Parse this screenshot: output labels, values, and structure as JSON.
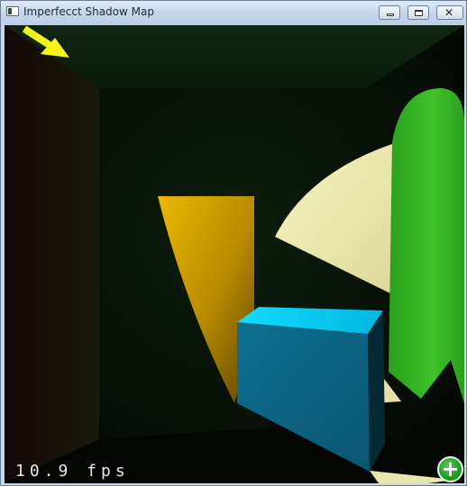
{
  "window": {
    "title": "Imperfecct Shadow Map",
    "icon": "window-app-icon"
  },
  "controls": {
    "minimize": "minimize-icon",
    "maximize": "maximize-icon",
    "close": "✕"
  },
  "overlay": {
    "fps_text": "10.9 fps",
    "add_button_glyph": "+",
    "light_pointer": "arrow-pointer-icon"
  },
  "colors": {
    "yellow_quad": "#e0a800",
    "cyan_box_top": "#18e6ff",
    "blue_box_side": "#0e6a8a",
    "green_shape": "#37b826",
    "light_patch": "#f3f2b8",
    "arrow": "#f7f21a"
  }
}
